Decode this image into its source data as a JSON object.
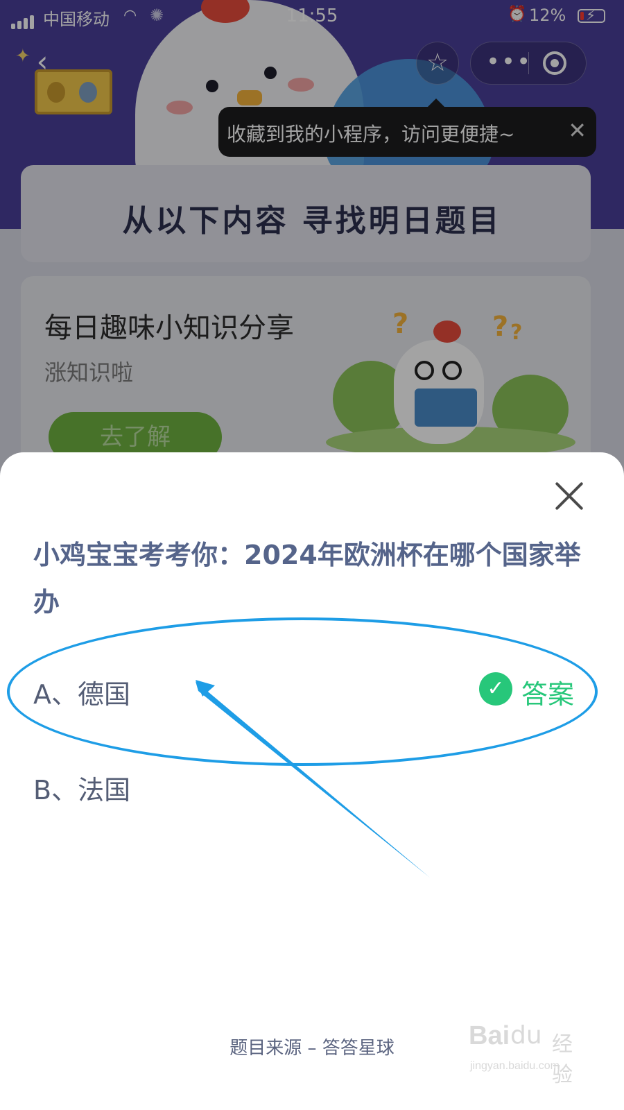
{
  "status_bar": {
    "carrier": "中国移动",
    "time": "11:55",
    "battery": "12%"
  },
  "navbar": {
    "back_glyph": "‹",
    "star_glyph": "☆",
    "more_glyph": "•••",
    "icons": [
      "back-icon",
      "star-icon",
      "more-icon",
      "target-icon"
    ]
  },
  "tooltip": {
    "text": "收藏到我的小程序，访问更便捷~",
    "close_glyph": "✕"
  },
  "banner": {
    "title": "从以下内容 寻找明日题目"
  },
  "knowledge_card": {
    "title": "每日趣味小知识分享",
    "subtitle": "涨知识啦",
    "button": "去了解"
  },
  "quiz": {
    "question": "小鸡宝宝考考你：2024年欧洲杯在哪个国家举办",
    "options": [
      {
        "label": "A、德国",
        "is_answer": true
      },
      {
        "label": "B、法国",
        "is_answer": false
      }
    ],
    "answer_label": "答案",
    "check_glyph": "✓",
    "source": "题目来源 – 答答星球"
  },
  "watermark": {
    "logo": "Bai",
    "paw": "du",
    "text": "经验",
    "url": "jingyan.baidu.com"
  },
  "colors": {
    "answer_green": "#27c77a",
    "question_blue": "#55648a",
    "annotation_blue": "#1e9de6"
  }
}
